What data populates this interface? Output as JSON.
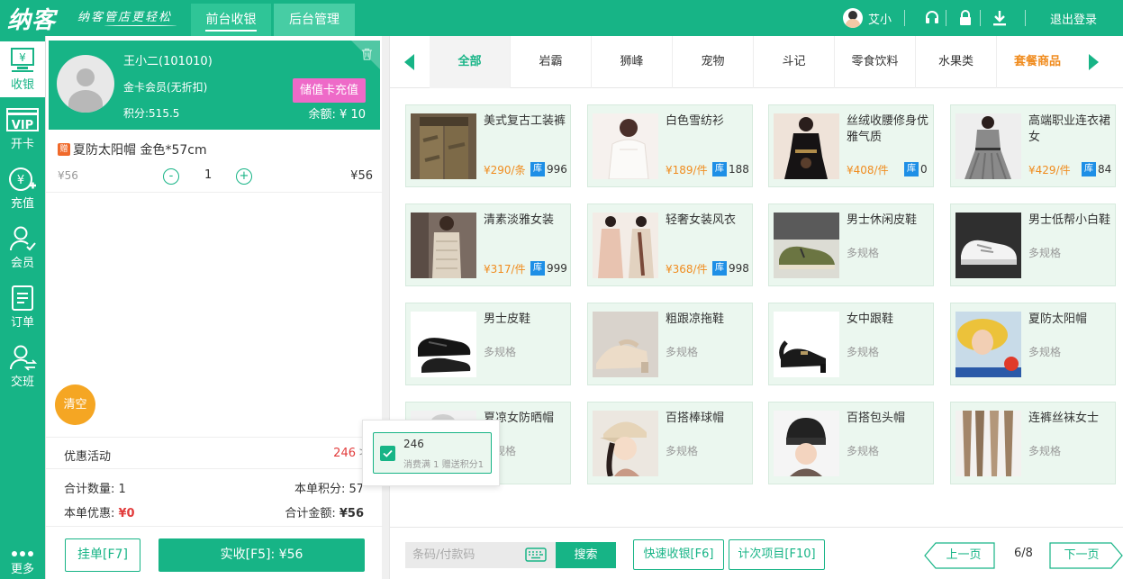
{
  "colors": {
    "primary": "#17b486",
    "accent_orange": "#f08c1f",
    "recharge_pink": "#ee6ac8",
    "stock_blue": "#1e8fe6",
    "danger_red": "#e23c3c"
  },
  "header": {
    "logo": "纳客",
    "slogan": "纳客管店更轻松",
    "tabs": [
      {
        "label": "前台收银",
        "active": true
      },
      {
        "label": "后台管理",
        "active": false
      }
    ],
    "user": "艾小",
    "icons": [
      "headset-icon",
      "lock-icon",
      "download-icon"
    ],
    "logout": "退出登录"
  },
  "sidebar": {
    "items": [
      {
        "label": "收银",
        "icon": "cashier-icon",
        "active": true
      },
      {
        "label": "开卡",
        "icon": "vip-card-icon",
        "active": false
      },
      {
        "label": "充值",
        "icon": "recharge-icon",
        "active": false
      },
      {
        "label": "会员",
        "icon": "member-icon",
        "active": false
      },
      {
        "label": "订单",
        "icon": "order-icon",
        "active": false
      },
      {
        "label": "交班",
        "icon": "shift-icon",
        "active": false
      },
      {
        "label": "更多",
        "icon": "more-icon",
        "active": false
      }
    ]
  },
  "member": {
    "name": "王小二(101010)",
    "level": "金卡会员(无折扣)",
    "points": "积分:515.5",
    "recharge_button": "储值卡充值",
    "balance": "余额: ¥ 10"
  },
  "cart": {
    "items": [
      {
        "tag": "赠",
        "name": "夏防太阳帽 金色*57cm",
        "price": "¥56",
        "minus": "-",
        "qty": "1",
        "plus": "+",
        "subtotal": "¥56"
      }
    ],
    "clear_button": "清空",
    "promo_label": "优惠活动",
    "promo_value": "246",
    "promo_arrow": ">",
    "total_qty": "合计数量: 1",
    "order_points": "本单积分: 57",
    "order_discount_label": "本单优惠: ",
    "order_discount_value": "¥0",
    "total_amount_label": "合计金额: ",
    "total_amount_value": "¥56",
    "hang_button": "挂单[F7]",
    "pay_button": "实收[F5]: ¥56"
  },
  "categories": {
    "tabs": [
      {
        "label": "全部",
        "active": true
      },
      {
        "label": "岩霸"
      },
      {
        "label": "狮峰"
      },
      {
        "label": "宠物"
      },
      {
        "label": "斗记"
      },
      {
        "label": "零食饮料"
      },
      {
        "label": "水果类"
      },
      {
        "label": "套餐商品",
        "combo": true
      }
    ]
  },
  "products": [
    {
      "name": "美式复古工装裤",
      "price": "¥290/条",
      "stock": "996",
      "img": "pants"
    },
    {
      "name": "白色雪纺衫",
      "price": "¥189/件",
      "stock": "188",
      "img": "blouse"
    },
    {
      "name": "丝绒收腰修身优雅气质",
      "price": "¥408/件",
      "stock": "0",
      "img": "velvet"
    },
    {
      "name": "高端职业连衣裙女",
      "price": "¥429/件",
      "stock": "84",
      "img": "dress"
    },
    {
      "name": "清素淡雅女装",
      "price": "¥317/件",
      "stock": "999",
      "img": "lace"
    },
    {
      "name": "轻奢女装风衣",
      "price": "¥368/件",
      "stock": "998",
      "img": "coat"
    },
    {
      "name": "男士休闲皮鞋",
      "spec": "多规格",
      "img": "shoe-olive"
    },
    {
      "name": "男士低帮小白鞋",
      "spec": "多规格",
      "img": "sneaker"
    },
    {
      "name": "男士皮鞋",
      "spec": "多规格",
      "img": "leather"
    },
    {
      "name": "粗跟凉拖鞋",
      "spec": "多规格",
      "img": "mule"
    },
    {
      "name": "女中跟鞋",
      "spec": "多规格",
      "img": "heel"
    },
    {
      "name": "夏防太阳帽",
      "spec": "多规格",
      "img": "sunhat"
    },
    {
      "name": "夏凉女防晒帽",
      "spec": "多规格",
      "img": "hat"
    },
    {
      "name": "百搭棒球帽",
      "spec": "多规格",
      "img": "cap"
    },
    {
      "name": "百搭包头帽",
      "spec": "多规格",
      "img": "beanie"
    },
    {
      "name": "连裤丝袜女士",
      "spec": "多规格",
      "img": "tights"
    }
  ],
  "stock_label": "库",
  "bottom": {
    "search_placeholder": "条码/付款码",
    "search_button": "搜索",
    "quick_cashier": "快速收银[F6]",
    "count_items": "计次项目[F10]",
    "prev": "上一页",
    "page": "6/8",
    "next": "下一页"
  },
  "promo_popup": {
    "value": "246",
    "desc": "消费满 1 赠送积分1"
  }
}
